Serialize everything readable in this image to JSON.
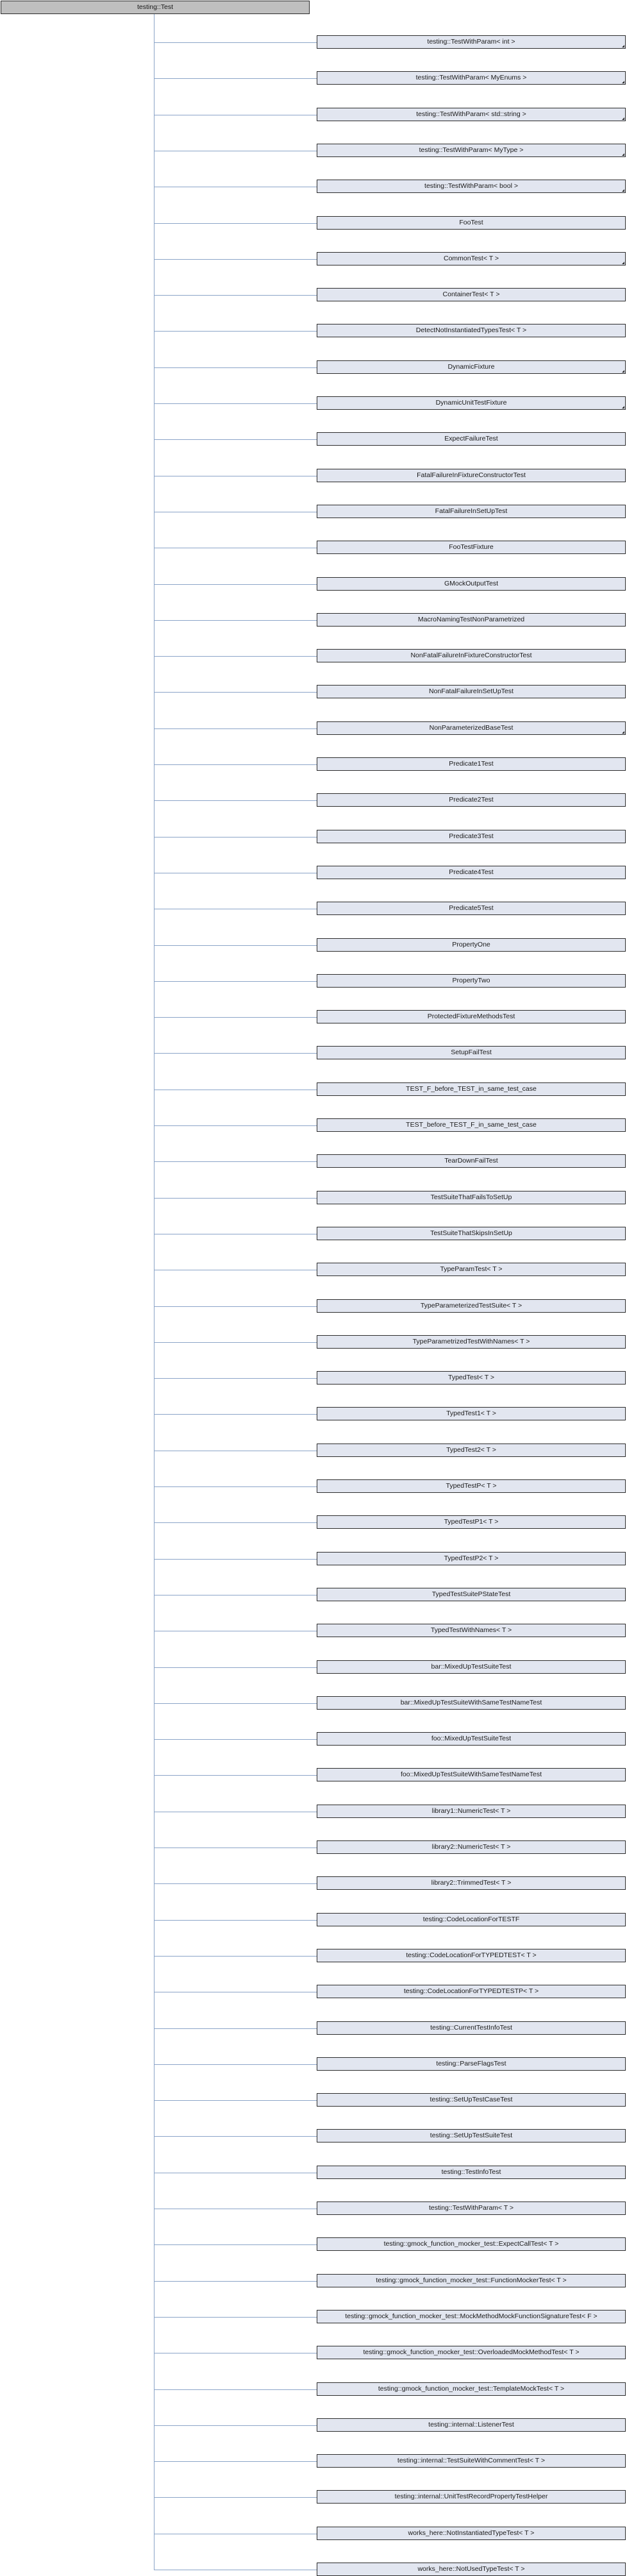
{
  "root": {
    "label": "testing::Test"
  },
  "children": [
    {
      "label": "testing::TestWithParam< int >",
      "expandable": true
    },
    {
      "label": "testing::TestWithParam< MyEnums >",
      "expandable": true
    },
    {
      "label": "testing::TestWithParam< std::string >",
      "expandable": true
    },
    {
      "label": "testing::TestWithParam< MyType >",
      "expandable": true
    },
    {
      "label": "testing::TestWithParam< bool >",
      "expandable": true
    },
    {
      "label": "FooTest",
      "expandable": false
    },
    {
      "label": "CommonTest< T >",
      "expandable": true
    },
    {
      "label": "ContainerTest< T >",
      "expandable": false
    },
    {
      "label": "DetectNotInstantiatedTypesTest< T >",
      "expandable": false
    },
    {
      "label": "DynamicFixture",
      "expandable": true
    },
    {
      "label": "DynamicUnitTestFixture",
      "expandable": true
    },
    {
      "label": "ExpectFailureTest",
      "expandable": false
    },
    {
      "label": "FatalFailureInFixtureConstructorTest",
      "expandable": false
    },
    {
      "label": "FatalFailureInSetUpTest",
      "expandable": false
    },
    {
      "label": "FooTestFixture",
      "expandable": false
    },
    {
      "label": "GMockOutputTest",
      "expandable": false
    },
    {
      "label": "MacroNamingTestNonParametrized",
      "expandable": false
    },
    {
      "label": "NonFatalFailureInFixtureConstructorTest",
      "expandable": false
    },
    {
      "label": "NonFatalFailureInSetUpTest",
      "expandable": false
    },
    {
      "label": "NonParameterizedBaseTest",
      "expandable": true
    },
    {
      "label": "Predicate1Test",
      "expandable": false
    },
    {
      "label": "Predicate2Test",
      "expandable": false
    },
    {
      "label": "Predicate3Test",
      "expandable": false
    },
    {
      "label": "Predicate4Test",
      "expandable": false
    },
    {
      "label": "Predicate5Test",
      "expandable": false
    },
    {
      "label": "PropertyOne",
      "expandable": false
    },
    {
      "label": "PropertyTwo",
      "expandable": false
    },
    {
      "label": "ProtectedFixtureMethodsTest",
      "expandable": false
    },
    {
      "label": "SetupFailTest",
      "expandable": false
    },
    {
      "label": "TEST_F_before_TEST_in_same_test_case",
      "expandable": false
    },
    {
      "label": "TEST_before_TEST_F_in_same_test_case",
      "expandable": false
    },
    {
      "label": "TearDownFailTest",
      "expandable": false
    },
    {
      "label": "TestSuiteThatFailsToSetUp",
      "expandable": false
    },
    {
      "label": "TestSuiteThatSkipsInSetUp",
      "expandable": false
    },
    {
      "label": "TypeParamTest< T >",
      "expandable": false
    },
    {
      "label": "TypeParameterizedTestSuite< T >",
      "expandable": false
    },
    {
      "label": "TypeParametrizedTestWithNames< T >",
      "expandable": false
    },
    {
      "label": "TypedTest< T >",
      "expandable": false
    },
    {
      "label": "TypedTest1< T >",
      "expandable": false
    },
    {
      "label": "TypedTest2< T >",
      "expandable": false
    },
    {
      "label": "TypedTestP< T >",
      "expandable": false
    },
    {
      "label": "TypedTestP1< T >",
      "expandable": false
    },
    {
      "label": "TypedTestP2< T >",
      "expandable": false
    },
    {
      "label": "TypedTestSuitePStateTest",
      "expandable": false
    },
    {
      "label": "TypedTestWithNames< T >",
      "expandable": false
    },
    {
      "label": "bar::MixedUpTestSuiteTest",
      "expandable": false
    },
    {
      "label": "bar::MixedUpTestSuiteWithSameTestNameTest",
      "expandable": false
    },
    {
      "label": "foo::MixedUpTestSuiteTest",
      "expandable": false
    },
    {
      "label": "foo::MixedUpTestSuiteWithSameTestNameTest",
      "expandable": false
    },
    {
      "label": "library1::NumericTest< T >",
      "expandable": false
    },
    {
      "label": "library2::NumericTest< T >",
      "expandable": false
    },
    {
      "label": "library2::TrimmedTest< T >",
      "expandable": false
    },
    {
      "label": "testing::CodeLocationForTESTF",
      "expandable": false
    },
    {
      "label": "testing::CodeLocationForTYPEDTEST< T >",
      "expandable": false
    },
    {
      "label": "testing::CodeLocationForTYPEDTESTP< T >",
      "expandable": false
    },
    {
      "label": "testing::CurrentTestInfoTest",
      "expandable": false
    },
    {
      "label": "testing::ParseFlagsTest",
      "expandable": false
    },
    {
      "label": "testing::SetUpTestCaseTest",
      "expandable": false
    },
    {
      "label": "testing::SetUpTestSuiteTest",
      "expandable": false
    },
    {
      "label": "testing::TestInfoTest",
      "expandable": false
    },
    {
      "label": "testing::TestWithParam< T >",
      "expandable": false
    },
    {
      "label": "testing::gmock_function_mocker_test::ExpectCallTest< T >",
      "expandable": false
    },
    {
      "label": "testing::gmock_function_mocker_test::FunctionMockerTest< T >",
      "expandable": false
    },
    {
      "label": "testing::gmock_function_mocker_test::MockMethodMockFunctionSignatureTest< F >",
      "expandable": false
    },
    {
      "label": "testing::gmock_function_mocker_test::OverloadedMockMethodTest< T >",
      "expandable": false
    },
    {
      "label": "testing::gmock_function_mocker_test::TemplateMockTest< T >",
      "expandable": false
    },
    {
      "label": "testing::internal::ListenerTest",
      "expandable": false
    },
    {
      "label": "testing::internal::TestSuiteWithCommentTest< T >",
      "expandable": false
    },
    {
      "label": "testing::internal::UnitTestRecordPropertyTestHelper",
      "expandable": false
    },
    {
      "label": "works_here::NotInstantiatedTypeTest< T >",
      "expandable": false
    },
    {
      "label": "works_here::NotUsedTypeTest< T >",
      "expandable": false
    }
  ]
}
